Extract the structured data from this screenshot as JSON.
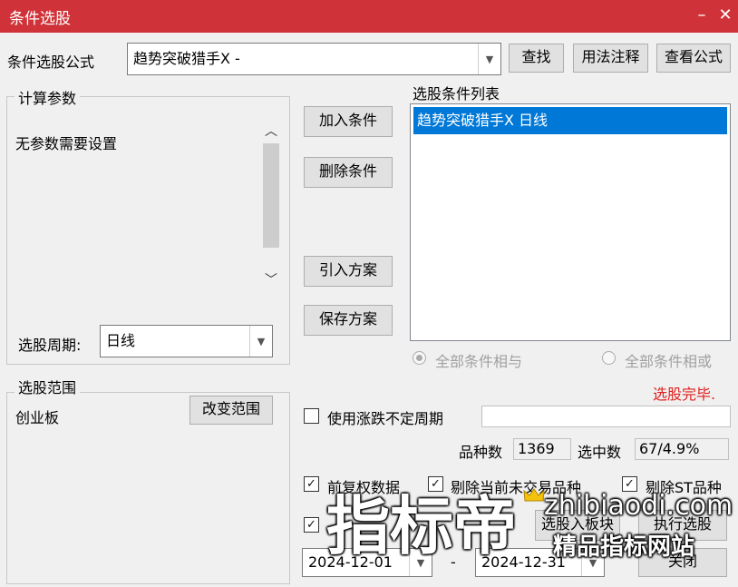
{
  "window": {
    "title": "条件选股",
    "minimize_glyph": "–",
    "close_glyph": "✕",
    "accent": "#cf3339"
  },
  "formula": {
    "label": "条件选股公式",
    "value": "趋势突破猎手X  -",
    "search_btn": "查找",
    "usage_btn": "用法注释",
    "view_btn": "查看公式"
  },
  "params": {
    "group_label": "计算参数",
    "message": "无参数需要设置",
    "period_label": "选股周期:",
    "period_value": "日线"
  },
  "actions": {
    "add": "加入条件",
    "remove": "删除条件",
    "import": "引入方案",
    "save": "保存方案"
  },
  "conditions": {
    "label": "选股条件列表",
    "items": [
      "趋势突破猎手X  日线"
    ],
    "selected_color": "#0078d7",
    "and_label": "全部条件相与",
    "or_label": "全部条件相或"
  },
  "status": {
    "text": "选股完毕.",
    "color": "#e0201c"
  },
  "scope": {
    "group_label": "选股范围",
    "value": "创业板",
    "change_btn": "改变范围"
  },
  "options": {
    "variable_period": "使用涨跌不定周期",
    "count_label": "品种数",
    "count_value": "1369",
    "selected_label": "选中数",
    "selected_value": "67/4.9%",
    "adjusted": "前复权数据",
    "exclude_untraded": "剔除当前未交易品种",
    "exclude_st": "剔除ST品种",
    "range_separator": "-"
  },
  "bottom": {
    "date_from": "2024-12-01",
    "date_to": "2024-12-31",
    "to_block_btn": "选股入板块",
    "run_btn": "执行选股",
    "close_btn": "关闭"
  },
  "watermark": {
    "big": "指标帝",
    "url": "zhibiaodi.com",
    "tagline": "精品指标网站"
  }
}
